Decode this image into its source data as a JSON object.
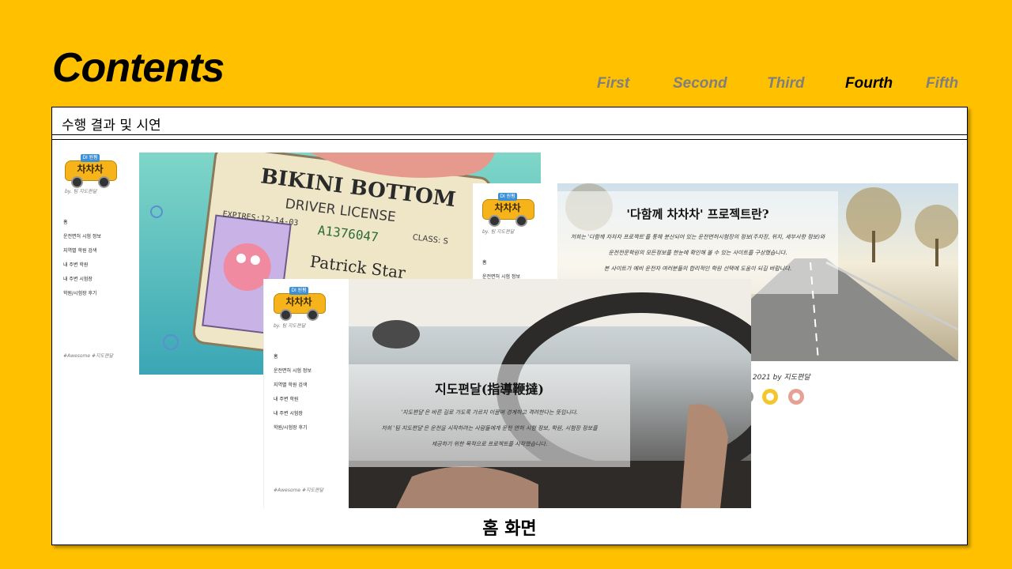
{
  "page": {
    "title": "Contents"
  },
  "nav": {
    "items": [
      {
        "label": "First",
        "active": false
      },
      {
        "label": "Second",
        "active": false
      },
      {
        "label": "Third",
        "active": false
      },
      {
        "label": "Fourth",
        "active": true
      },
      {
        "label": "Fifth",
        "active": false
      }
    ]
  },
  "panel": {
    "header": "수행 결과 및 시연",
    "caption": "홈 화면"
  },
  "site": {
    "logo_sign": "DI 원펌",
    "logo_name": "차차차",
    "tagline": "by. 팀 지도편달",
    "menu": [
      "홈",
      "운전면허 시험 정보",
      "지역별 학원 검색",
      "내 주변 학원",
      "내 주변 시험장",
      "학원/시험장 후기"
    ],
    "footer": "#Awesome #지도편달",
    "copyright": "ⓒ 2021 by 지도편달"
  },
  "screens": {
    "license": {
      "name": "BIKINI BOTTOM",
      "type": "DRIVER LICENSE",
      "expires": "EXPIRES:12-14-03",
      "number": "A1376047",
      "class": "CLASS: S",
      "holder": "Patrick Star"
    },
    "project": {
      "title": "'다함께 차차차' 프로젝트란?",
      "lines": [
        "저희는 '다함께 차차차 프로젝트'를 통해 분산되어 있는 운전면허시험장의 정보(주차장, 위치, 세부사항 정보)와",
        "운전전문학원의 모든정보를 한눈에 확인해 볼 수 있는 사이트를 구상했습니다.",
        "본 사이트가 예비 운전자 여러분들의 합리적인 학원 선택에 도움이 되길 바랍니다."
      ]
    },
    "team": {
      "title": "지도편달(指導鞭撻)",
      "lines": [
        "'지도편달'은 바른 길로 가도록 가르치 이끌며 경계하고 격려한다는 뜻입니다.",
        "저희 '팀 지도편달'은 운전을 시작하려는 사람들에게 운전 면허 시험 정보, 학원, 시험장 정보를",
        "제공하기 위한 목적으로 프로젝트를 시작했습니다."
      ]
    }
  }
}
